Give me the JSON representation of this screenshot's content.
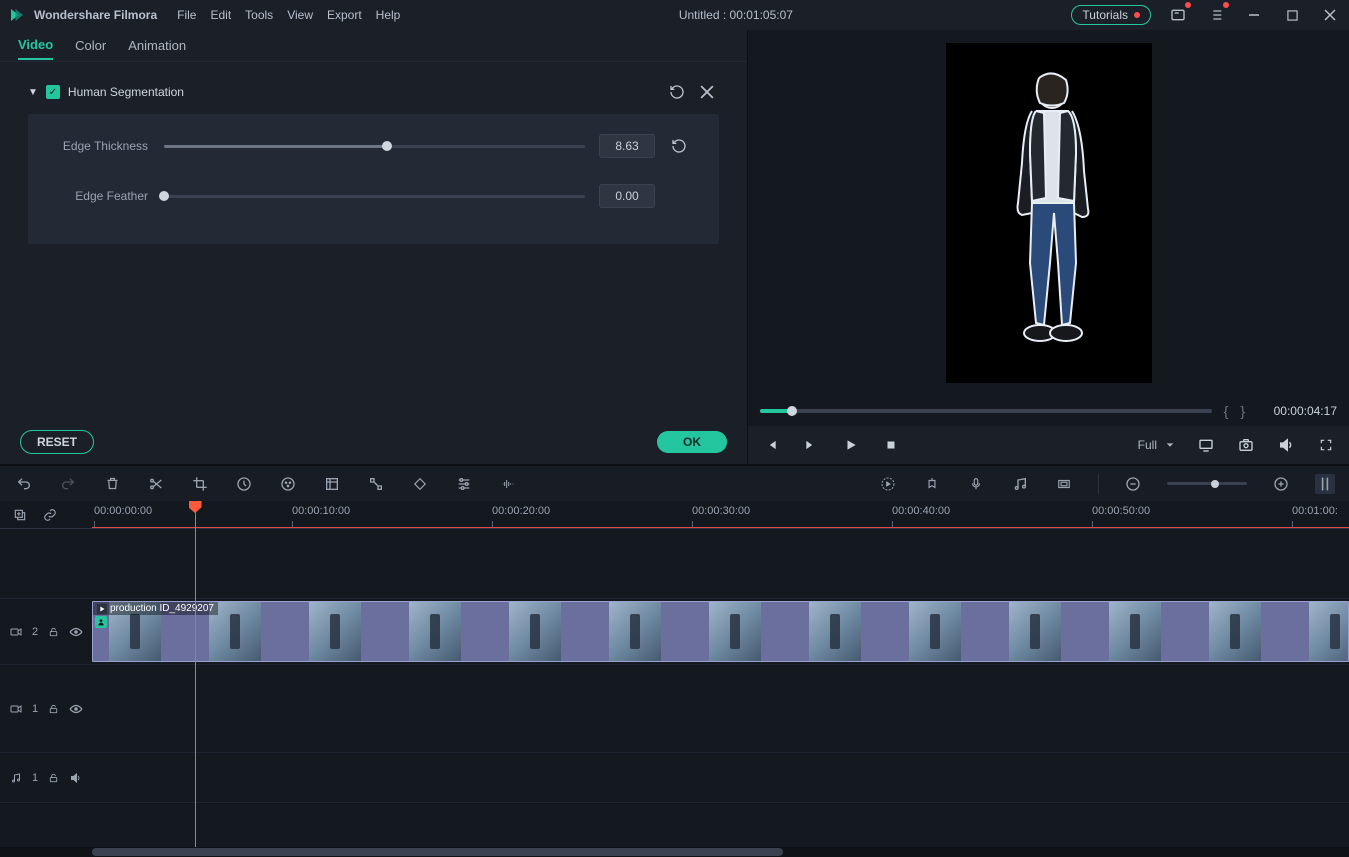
{
  "app": {
    "brand": "Wondershare Filmora",
    "menu": [
      "File",
      "Edit",
      "Tools",
      "View",
      "Export",
      "Help"
    ],
    "title": "Untitled : 00:01:05:07",
    "tutorials": "Tutorials"
  },
  "panel": {
    "tabs": [
      {
        "label": "Video",
        "active": true
      },
      {
        "label": "Color",
        "active": false
      },
      {
        "label": "Animation",
        "active": false
      }
    ],
    "effect": {
      "name": "Human Segmentation",
      "enabled": true,
      "params": [
        {
          "label": "Edge Thickness",
          "value": "8.63",
          "pct": 53
        },
        {
          "label": "Edge Feather",
          "value": "0.00",
          "pct": 0
        }
      ]
    },
    "reset": "RESET",
    "ok": "OK"
  },
  "preview": {
    "scrub_pct": 7,
    "time": "00:00:04:17",
    "quality": "Full"
  },
  "timeline": {
    "ruler_start": "00:00:00:00",
    "marks": [
      "00:00:10:00",
      "00:00:20:00",
      "00:00:30:00",
      "00:00:40:00",
      "00:00:50:00",
      "00:01:00:"
    ],
    "playhead_pct": 7.6,
    "clip_name": "production ID_4929207",
    "tracks": {
      "video2": "2",
      "video1": "1",
      "audio1": "1"
    },
    "zoom_pct": 60
  }
}
